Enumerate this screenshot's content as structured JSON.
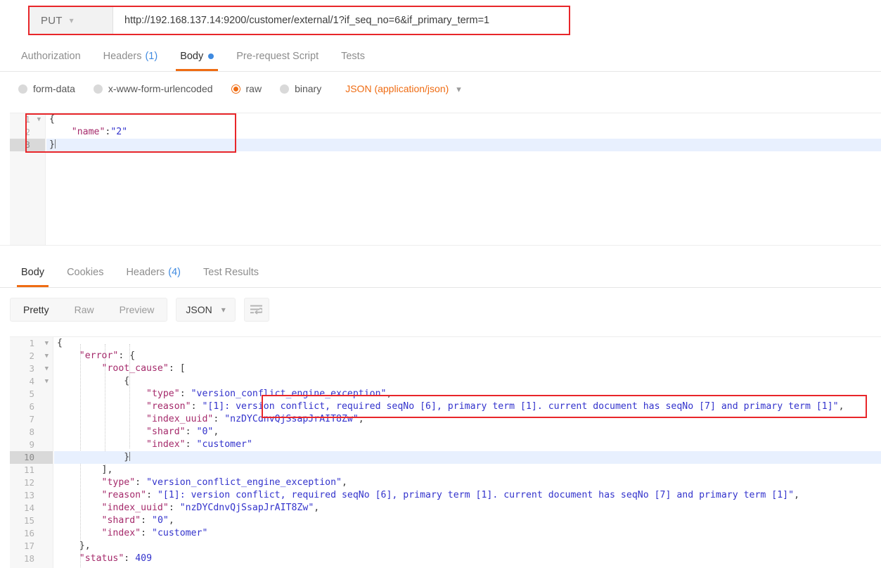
{
  "request": {
    "method": "PUT",
    "method_caret": "chevron-down",
    "url": "http://192.168.137.14:9200/customer/external/1?if_seq_no=6&if_primary_term=1",
    "tabs": [
      {
        "label": "Authorization",
        "count": "",
        "dot": false,
        "active": false
      },
      {
        "label": "Headers",
        "count": "(1)",
        "dot": false,
        "active": false
      },
      {
        "label": "Body",
        "count": "",
        "dot": true,
        "active": true
      },
      {
        "label": "Pre-request Script",
        "count": "",
        "dot": false,
        "active": false
      },
      {
        "label": "Tests",
        "count": "",
        "dot": false,
        "active": false
      }
    ],
    "body_types": [
      {
        "label": "form-data",
        "selected": false
      },
      {
        "label": "x-www-form-urlencoded",
        "selected": false
      },
      {
        "label": "raw",
        "selected": true
      },
      {
        "label": "binary",
        "selected": false
      }
    ],
    "content_type": "JSON (application/json)",
    "content_type_caret": "chevron-down",
    "body_lines": [
      {
        "num": "1",
        "fold": true,
        "current": false,
        "tokens": [
          {
            "t": "{",
            "c": "brace"
          }
        ]
      },
      {
        "num": "2",
        "fold": false,
        "current": false,
        "tokens": [
          {
            "t": "    ",
            "c": "punct"
          },
          {
            "t": "\"name\"",
            "c": "key"
          },
          {
            "t": ":",
            "c": "punct"
          },
          {
            "t": "\"2\"",
            "c": "str"
          }
        ]
      },
      {
        "num": "3",
        "fold": false,
        "current": true,
        "tokens": [
          {
            "t": "}",
            "c": "brace"
          }
        ]
      }
    ]
  },
  "response": {
    "tabs": [
      {
        "label": "Body",
        "count": "",
        "active": true
      },
      {
        "label": "Cookies",
        "count": "",
        "active": false
      },
      {
        "label": "Headers",
        "count": "(4)",
        "active": false
      },
      {
        "label": "Test Results",
        "count": "",
        "active": false
      }
    ],
    "view_modes": [
      {
        "label": "Pretty",
        "active": true
      },
      {
        "label": "Raw",
        "active": false
      },
      {
        "label": "Preview",
        "active": false
      }
    ],
    "format": "JSON",
    "format_caret": "chevron-down",
    "wrap_button": "word-wrap-icon",
    "body_lines": [
      {
        "num": "1",
        "fold": true,
        "current": false,
        "tokens": [
          {
            "t": "{",
            "c": "brace"
          }
        ]
      },
      {
        "num": "2",
        "fold": true,
        "current": false,
        "tokens": [
          {
            "t": "    ",
            "c": "punct"
          },
          {
            "t": "\"error\"",
            "c": "key"
          },
          {
            "t": ": ",
            "c": "punct"
          },
          {
            "t": "{",
            "c": "brace"
          }
        ]
      },
      {
        "num": "3",
        "fold": true,
        "current": false,
        "tokens": [
          {
            "t": "        ",
            "c": "punct"
          },
          {
            "t": "\"root_cause\"",
            "c": "key"
          },
          {
            "t": ": ",
            "c": "punct"
          },
          {
            "t": "[",
            "c": "brace"
          }
        ]
      },
      {
        "num": "4",
        "fold": true,
        "current": false,
        "tokens": [
          {
            "t": "            ",
            "c": "punct"
          },
          {
            "t": "{",
            "c": "brace"
          }
        ]
      },
      {
        "num": "5",
        "fold": false,
        "current": false,
        "tokens": [
          {
            "t": "                ",
            "c": "punct"
          },
          {
            "t": "\"type\"",
            "c": "key"
          },
          {
            "t": ": ",
            "c": "punct"
          },
          {
            "t": "\"version_conflict_engine_exception\"",
            "c": "str"
          },
          {
            "t": ",",
            "c": "punct"
          }
        ]
      },
      {
        "num": "6",
        "fold": false,
        "current": false,
        "tokens": [
          {
            "t": "                ",
            "c": "punct"
          },
          {
            "t": "\"reason\"",
            "c": "key"
          },
          {
            "t": ": ",
            "c": "punct"
          },
          {
            "t": "\"[1]: version conflict, required seqNo [6], primary term [1]. current document has seqNo [7] and primary term [1]\"",
            "c": "str"
          },
          {
            "t": ",",
            "c": "punct"
          }
        ]
      },
      {
        "num": "7",
        "fold": false,
        "current": false,
        "tokens": [
          {
            "t": "                ",
            "c": "punct"
          },
          {
            "t": "\"index_uuid\"",
            "c": "key"
          },
          {
            "t": ": ",
            "c": "punct"
          },
          {
            "t": "\"nzDYCdnvQjSsapJrAIT8Zw\"",
            "c": "str"
          },
          {
            "t": ",",
            "c": "punct"
          }
        ]
      },
      {
        "num": "8",
        "fold": false,
        "current": false,
        "tokens": [
          {
            "t": "                ",
            "c": "punct"
          },
          {
            "t": "\"shard\"",
            "c": "key"
          },
          {
            "t": ": ",
            "c": "punct"
          },
          {
            "t": "\"0\"",
            "c": "str"
          },
          {
            "t": ",",
            "c": "punct"
          }
        ]
      },
      {
        "num": "9",
        "fold": false,
        "current": false,
        "tokens": [
          {
            "t": "                ",
            "c": "punct"
          },
          {
            "t": "\"index\"",
            "c": "key"
          },
          {
            "t": ": ",
            "c": "punct"
          },
          {
            "t": "\"customer\"",
            "c": "str"
          }
        ]
      },
      {
        "num": "10",
        "fold": false,
        "current": true,
        "tokens": [
          {
            "t": "            ",
            "c": "punct"
          },
          {
            "t": "}",
            "c": "brace"
          }
        ]
      },
      {
        "num": "11",
        "fold": false,
        "current": false,
        "tokens": [
          {
            "t": "        ",
            "c": "punct"
          },
          {
            "t": "]",
            "c": "brace"
          },
          {
            "t": ",",
            "c": "punct"
          }
        ]
      },
      {
        "num": "12",
        "fold": false,
        "current": false,
        "tokens": [
          {
            "t": "        ",
            "c": "punct"
          },
          {
            "t": "\"type\"",
            "c": "key"
          },
          {
            "t": ": ",
            "c": "punct"
          },
          {
            "t": "\"version_conflict_engine_exception\"",
            "c": "str"
          },
          {
            "t": ",",
            "c": "punct"
          }
        ]
      },
      {
        "num": "13",
        "fold": false,
        "current": false,
        "tokens": [
          {
            "t": "        ",
            "c": "punct"
          },
          {
            "t": "\"reason\"",
            "c": "key"
          },
          {
            "t": ": ",
            "c": "punct"
          },
          {
            "t": "\"[1]: version conflict, required seqNo [6], primary term [1]. current document has seqNo [7] and primary term [1]\"",
            "c": "str"
          },
          {
            "t": ",",
            "c": "punct"
          }
        ]
      },
      {
        "num": "14",
        "fold": false,
        "current": false,
        "tokens": [
          {
            "t": "        ",
            "c": "punct"
          },
          {
            "t": "\"index_uuid\"",
            "c": "key"
          },
          {
            "t": ": ",
            "c": "punct"
          },
          {
            "t": "\"nzDYCdnvQjSsapJrAIT8Zw\"",
            "c": "str"
          },
          {
            "t": ",",
            "c": "punct"
          }
        ]
      },
      {
        "num": "15",
        "fold": false,
        "current": false,
        "tokens": [
          {
            "t": "        ",
            "c": "punct"
          },
          {
            "t": "\"shard\"",
            "c": "key"
          },
          {
            "t": ": ",
            "c": "punct"
          },
          {
            "t": "\"0\"",
            "c": "str"
          },
          {
            "t": ",",
            "c": "punct"
          }
        ]
      },
      {
        "num": "16",
        "fold": false,
        "current": false,
        "tokens": [
          {
            "t": "        ",
            "c": "punct"
          },
          {
            "t": "\"index\"",
            "c": "key"
          },
          {
            "t": ": ",
            "c": "punct"
          },
          {
            "t": "\"customer\"",
            "c": "str"
          }
        ]
      },
      {
        "num": "17",
        "fold": false,
        "current": false,
        "tokens": [
          {
            "t": "    ",
            "c": "punct"
          },
          {
            "t": "}",
            "c": "brace"
          },
          {
            "t": ",",
            "c": "punct"
          }
        ]
      },
      {
        "num": "18",
        "fold": false,
        "current": false,
        "tokens": [
          {
            "t": "    ",
            "c": "punct"
          },
          {
            "t": "\"status\"",
            "c": "key"
          },
          {
            "t": ": ",
            "c": "punct"
          },
          {
            "t": "409",
            "c": "num"
          }
        ]
      }
    ]
  },
  "annotations": {
    "accent_orange": "#ef6c13",
    "accent_blue": "#3f8ae0",
    "highlight_red": "#e8262a"
  }
}
